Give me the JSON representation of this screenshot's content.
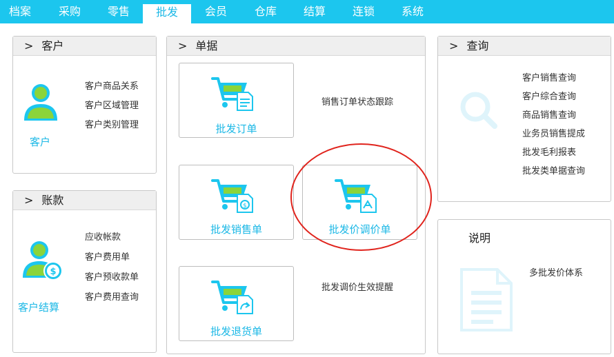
{
  "nav": {
    "items": [
      {
        "label": "档案"
      },
      {
        "label": "采购"
      },
      {
        "label": "零售"
      },
      {
        "label": "批发"
      },
      {
        "label": "会员"
      },
      {
        "label": "仓库"
      },
      {
        "label": "结算"
      },
      {
        "label": "连锁"
      },
      {
        "label": "系统"
      }
    ],
    "active": "批发"
  },
  "customer_panel": {
    "title": "客户",
    "chevron": ">",
    "icon_label": "客户",
    "links": [
      "客户商品关系",
      "客户区域管理",
      "客户类别管理"
    ]
  },
  "account_panel": {
    "title": "账款",
    "chevron": ">",
    "icon_label": "客户结算",
    "links": [
      "应收帐款",
      "客户费用单",
      "客户预收款单",
      "客户费用查询"
    ]
  },
  "docs_panel": {
    "title": "单据",
    "chevron": ">",
    "buttons": {
      "order": "批发订单",
      "sales": "批发销售单",
      "price_adjust": "批发价调价单",
      "return": "批发退货单"
    },
    "links": {
      "order_tracking": "销售订单状态跟踪",
      "price_reminder": "批发调价生效提醒"
    }
  },
  "query_panel": {
    "title": "查询",
    "chevron": ">",
    "links": [
      "客户销售查询",
      "客户综合查询",
      "商品销售查询",
      "业务员销售提成",
      "批发毛利报表",
      "批发类单据查询"
    ]
  },
  "notes_panel": {
    "title": "说明",
    "text": "多批发价体系"
  },
  "colors": {
    "accent": "#1cc6ee",
    "label_blue": "#1cb8e6",
    "icon_green": "#8bd43a",
    "highlight_red": "#e0231c"
  }
}
